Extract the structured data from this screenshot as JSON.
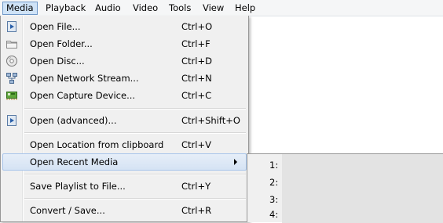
{
  "menubar": {
    "items": [
      {
        "label": "Media"
      },
      {
        "label": "Playback"
      },
      {
        "label": "Audio"
      },
      {
        "label": "Video"
      },
      {
        "label": "Tools"
      },
      {
        "label": "View"
      },
      {
        "label": "Help"
      }
    ]
  },
  "media_menu": {
    "items": [
      {
        "label": "Open File...",
        "shortcut": "Ctrl+O",
        "icon": "play-file-icon"
      },
      {
        "label": "Open Folder...",
        "shortcut": "Ctrl+F",
        "icon": "folder-icon"
      },
      {
        "label": "Open Disc...",
        "shortcut": "Ctrl+D",
        "icon": "disc-icon"
      },
      {
        "label": "Open Network Stream...",
        "shortcut": "Ctrl+N",
        "icon": "network-icon"
      },
      {
        "label": "Open Capture Device...",
        "shortcut": "Ctrl+C",
        "icon": "capture-card-icon"
      },
      {
        "label": "Open (advanced)...",
        "shortcut": "Ctrl+Shift+O",
        "icon": "play-file-icon"
      },
      {
        "label": "Open Location from clipboard",
        "shortcut": "Ctrl+V"
      },
      {
        "label": "Open Recent Media"
      },
      {
        "label": "Save Playlist to File...",
        "shortcut": "Ctrl+Y"
      },
      {
        "label": "Convert / Save...",
        "shortcut": "Ctrl+R"
      }
    ]
  },
  "recent_media": {
    "items": [
      {
        "num": "1:"
      },
      {
        "num": "2:"
      },
      {
        "num": "3:"
      },
      {
        "num": "4:"
      }
    ]
  },
  "colors": {
    "menu_bg": "#f0f0f0",
    "highlight": "#d5e3f4",
    "active_menubar": "#cfe3f7"
  }
}
